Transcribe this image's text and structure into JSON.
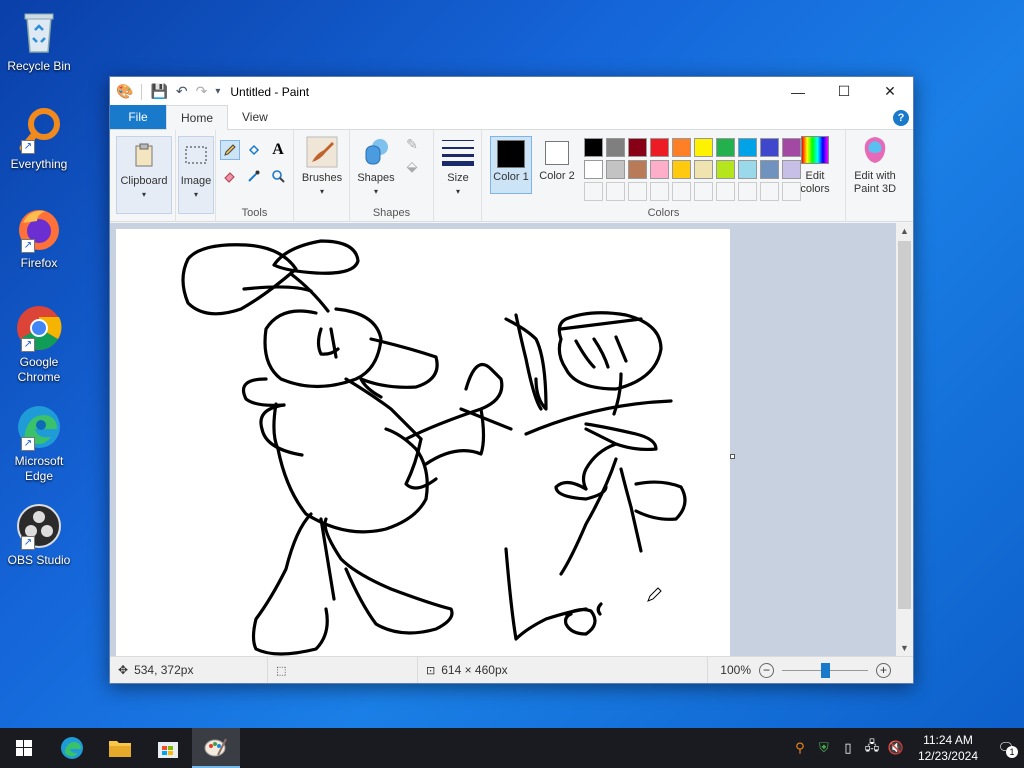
{
  "desktop": {
    "icons": [
      {
        "label": "Recycle Bin"
      },
      {
        "label": "Everything"
      },
      {
        "label": "Firefox"
      },
      {
        "label": "Google Chrome"
      },
      {
        "label": "Microsoft Edge"
      },
      {
        "label": "OBS Studio"
      }
    ]
  },
  "window": {
    "title": "Untitled - Paint",
    "tabs": {
      "file": "File",
      "home": "Home",
      "view": "View"
    },
    "help": "?"
  },
  "ribbon": {
    "clipboard": "Clipboard",
    "image": "Image",
    "tools": "Tools",
    "brushes": "Brushes",
    "shapes_btn": "Shapes",
    "shapes_group": "Shapes",
    "size": "Size",
    "color1": "Color 1",
    "color2": "Color 2",
    "colors": "Colors",
    "edit_colors": "Edit colors",
    "edit_with_3d": "Edit with Paint 3D",
    "palette_row1": [
      "#000000",
      "#7f7f7f",
      "#880015",
      "#ed1c24",
      "#ff7f27",
      "#fff200",
      "#22b14c",
      "#00a2e8",
      "#3f48cc",
      "#a349a4"
    ],
    "palette_row2": [
      "#ffffff",
      "#c3c3c3",
      "#b97a57",
      "#ffaec9",
      "#ffc90e",
      "#efe4b0",
      "#b5e61d",
      "#99d9ea",
      "#7092be",
      "#c8bfe7"
    ],
    "color1_value": "#000000",
    "color2_value": "#ffffff"
  },
  "status": {
    "cursor_pos": "534, 372px",
    "image_size": "614 × 460px",
    "zoom": "100%",
    "zoom_slider_fraction": 0.5
  },
  "taskbar": {
    "time": "11:24 AM",
    "date": "12/23/2024",
    "notification_count": "1"
  }
}
